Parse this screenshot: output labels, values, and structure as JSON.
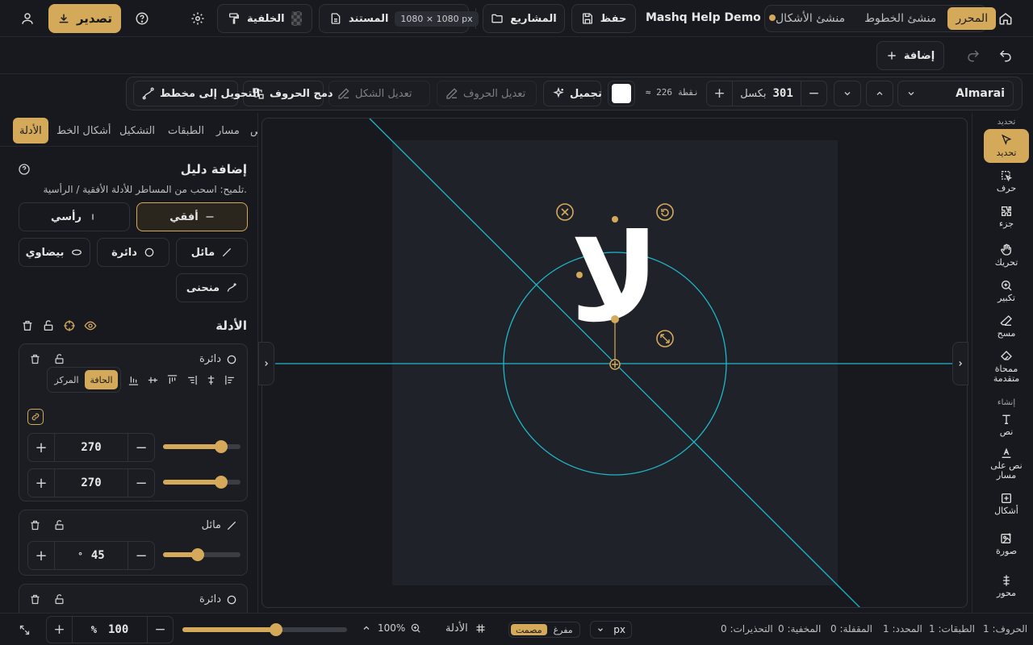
{
  "topbar": {
    "mode_tabs": [
      "المحرر",
      "منشئ الخطوط",
      "منشئ الأشكال"
    ],
    "active_mode": 0,
    "project_name": "Mashq Help Demo",
    "save_label": "حفظ",
    "projects_label": "المشاريع",
    "document_label": "المستند",
    "document_size": "1080 × 1080 px",
    "background_label": "الخلفية",
    "export_label": "تصدير"
  },
  "secondbar": {
    "add_label": "إضافة"
  },
  "toolbar": {
    "font_name": "Almarai",
    "font_size_value": "301",
    "font_size_unit": "بكسل",
    "points_text": "≈ 226 نقطة",
    "color_swatch": "#ffffff",
    "beautify_label": "تجميل",
    "edit_letters_label": "تعديل الحروف",
    "edit_shape_label": "تعديل الشكل",
    "merge_letters_label": "دمج الحروف",
    "convert_path_label": "التحويل إلى مخطط"
  },
  "leftpanel": {
    "tabs": [
      "الأدلة",
      "أشكال الخط",
      "التشكيل",
      "الطبقات",
      "مسار",
      "ص"
    ],
    "active_tab": 0,
    "add_guide_title": "إضافة دليل",
    "hint": "تلميح: اسحب من المساطر للأدلة الأفقية / الرأسية.",
    "guide_types": {
      "horizontal": "أفقي",
      "vertical": "رأسي",
      "diagonal": "مائل",
      "circle": "دائرة",
      "ellipse": "بيضاوي",
      "curve": "منحنى"
    },
    "guides_title": "الأدلة",
    "guide_cards": [
      {
        "type_label": "دائرة",
        "anchor_edge": "الحافة",
        "anchor_center": "المركز",
        "value1": "270",
        "value1_fraction": 0.75,
        "value2": "270",
        "value2_fraction": 0.75
      },
      {
        "type_label": "مائل",
        "value1": "45",
        "unit": "°",
        "value1_fraction": 0.45
      },
      {
        "type_label": "دائرة"
      }
    ]
  },
  "canvas": {
    "glyph_text": "لا"
  },
  "righttools": {
    "section_select": "تحديد",
    "section_create": "إنشاء",
    "items": [
      {
        "label": "تحديد",
        "icon": "pointer-icon"
      },
      {
        "label": "حرف",
        "icon": "letter-select-icon"
      },
      {
        "label": "جزء",
        "icon": "part-icon"
      },
      {
        "label": "تحريك",
        "icon": "hand-icon"
      },
      {
        "label": "تكبير",
        "icon": "zoom-icon"
      },
      {
        "label": "مسح",
        "icon": "eraser-icon"
      },
      {
        "label": "ممحاة متقدمة",
        "icon": "advanced-eraser-icon"
      },
      {
        "label": "نص",
        "icon": "text-icon"
      },
      {
        "label": "نص على مسار",
        "icon": "text-path-icon"
      },
      {
        "label": "أشكال",
        "icon": "shapes-icon"
      },
      {
        "label": "صورة",
        "icon": "image-icon"
      },
      {
        "label": "محور",
        "icon": "axis-icon"
      }
    ]
  },
  "statusbar": {
    "zoom_value": "100",
    "zoom_unit": "%",
    "zoom_slider_fraction": 0.57,
    "zoom_percent": "100%",
    "guides_label": "الأدلة",
    "fill_empty_label": "مفرغ",
    "fill_solid_label": "مصمت",
    "unit": "px",
    "stats": {
      "letters": "الحروف: 1",
      "layers": "الطبقات: 1",
      "selected": "المحدد: 1",
      "locked": "المقفلة: 0",
      "hidden": "المخفية: 0",
      "warnings": "التحذيرات: 0"
    }
  },
  "colors": {
    "accent": "#d4aa5a",
    "guide_line": "#1fb8c9",
    "background": "#17191e",
    "artboard": "#1f2229"
  }
}
